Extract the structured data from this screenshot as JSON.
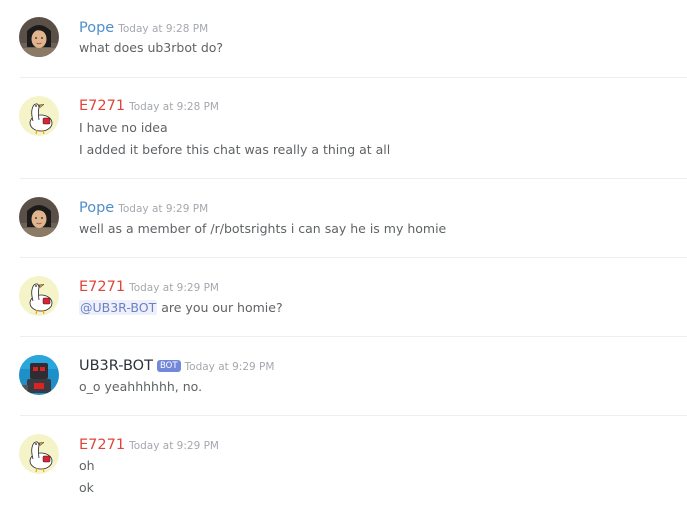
{
  "colors": {
    "pope": "#4f8ecc",
    "e7271": "#e0453a",
    "ub3r_bot": "#2e3338",
    "bot_tag_bg": "#7289da",
    "mention_text": "#6b81c4",
    "mention_bg": "#eef1fb"
  },
  "messages": [
    {
      "author": "Pope",
      "timestamp": "Today at 9:28 PM",
      "lines": [
        "what does ub3rbot do?"
      ]
    },
    {
      "author": "E7271",
      "timestamp": "Today at 9:28 PM",
      "lines": [
        "I have no idea",
        "I added it before this chat was really a thing at all"
      ]
    },
    {
      "author": "Pope",
      "timestamp": "Today at 9:29 PM",
      "lines": [
        "well as a member of /r/botsrights i can say he is my homie"
      ]
    },
    {
      "author": "E7271",
      "timestamp": "Today at 9:29 PM",
      "mention": "@UB3R-BOT",
      "lines": [
        " are you our homie?"
      ]
    },
    {
      "author": "UB3R-BOT",
      "bot_tag": "BOT",
      "timestamp": "Today at 9:29 PM",
      "lines": [
        "o_o yeahhhhhh, no."
      ]
    },
    {
      "author": "E7271",
      "timestamp": "Today at 9:29 PM",
      "lines": [
        "oh",
        "ok"
      ]
    }
  ]
}
